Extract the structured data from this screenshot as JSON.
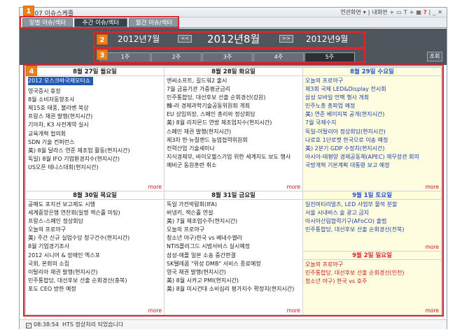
{
  "window": {
    "title": "4107 이슈스케줄"
  },
  "toolbar": {
    "items": [
      "연관화면",
      "▾",
      "|",
      "내화면",
      "+",
      "▭",
      "T",
      "+",
      "▦",
      "?",
      "|",
      "_",
      "✕"
    ]
  },
  "tabs": [
    {
      "label": "일별 이슈/섹터"
    },
    {
      "label": "주간 이슈/섹터"
    },
    {
      "label": "월간 이슈/섹터"
    }
  ],
  "nav": {
    "prev_month": "2012년7월",
    "current_month": "2012년8월",
    "next_month": "2012년9월",
    "prev_button": "<<",
    "next_button": ">>",
    "weeks": [
      "1주",
      "2주",
      "3주",
      "4주",
      "5주"
    ],
    "lookup_button": "조회"
  },
  "badges": [
    "1",
    "2",
    "3",
    "4"
  ],
  "days": [
    {
      "header": "8월 27일 월요일",
      "items": [
        "2012 모스크바국제모터쇼",
        "영국증시 휴장",
        "8월 소비자동향조사",
        "제15호 태풍, 볼라벤 북상",
        "프랑스 채권 발행(현지시간)",
        "기아차, K3 사전계약 실시",
        "교육개혁 협의회",
        "SDN 기술 컨퍼런스",
        "美) 8월 달라스 연준 제조업 활동(현지시간)",
        "독일) 8월 IFO 기업환경지수(현지시간)",
        "US오픈 테니스대회(현지시간)"
      ],
      "more": "more"
    },
    {
      "header": "8월 28일 화요일",
      "items": [
        "엔씨소프트, 길드워2 출시",
        "7월 금융기관 가중평균금리",
        "민주통합당, 대선후보 선출 순회경선(강원)",
        "韓-러 경제과학기술공동위원회 개최",
        "EU 상임의장, 스페인 총리와 정상회담",
        "美) 8월 리치몬드 연방 제조업지수(현지시간)",
        "스페인 채권 발행(현지시간)",
        "제3차 한·뉴질랜드 농업협력위원회",
        "전력산업 기술세미나",
        "지식경제부, 바이오헬스기업 위한 세계지도 보도 행사",
        "예비군 동원훈련 취소"
      ],
      "more": "more"
    },
    {
      "header": "8월 29일 수요일",
      "items": [
        "오늘의 프로야구",
        "제3회 국제 LED&Display 전시회",
        "삼성 모바일 언팩 행사 개최",
        "민주노총 총파업 예정",
        "美) 연준 베이지북 공개(현지시간)",
        "7월 국제수지",
        "독일-이탈리아 정상회담(현지시간)",
        "나로호 1단로켓 한국으로 이송 예정",
        "美) 2분기 GDP 수정치(현지시간)",
        "아시아-태평양 경제공동체(APEC) 재무장관 회의",
        "국방개혁 기본계획 대통령 보고 예정"
      ],
      "more": "more"
    },
    {
      "header": "8월 30일 목요일",
      "items": [
        "공매도 포지션 보고제도 시행",
        "세계중앙은행 연찬회(일명 잭슨홀 미팅)",
        "프랑스-스페인 정상회담",
        "오늘의 프로야구",
        "美) 주간 신규 실업수당 청구건수(현지시간)",
        "8월 기업경기조사",
        "2012 시니어 & 장애인 엑스포",
        "국회, 본회의 소집",
        "이탈리아 채권 발행(현지시간)",
        "민주통합당, 대선후보 선출 순회경선(충북)",
        "포도 CEO 방한 예정"
      ],
      "more": "more"
    },
    {
      "header": "8월 31일 금요일",
      "items": [
        "독일 가전박람회(IFA)",
        "버냉키, 잭슨홀 연설",
        "美) 7월 제조업수주(현지시간)",
        "오늘의 프로야구",
        "청소년 야구)한국 vs 베네수엘라",
        "NTIS플러그드 시범서비스 실시예정",
        "삼성-애플 일본 소송 중간판결",
        "SK텔레콤 \"위성 DMB\" 서비스 종료예정",
        "영국 채권 발행(현지시간)",
        "美) 8월 시카고 PMI(현지시간)",
        "美) 8월 미시건대 소비심리 평가지수 확정치(현지시간)"
      ],
      "more": "more"
    },
    {
      "header": "9월 1일 토요일",
      "items": [
        "일진머티리얼즈, LED 사업부 물적 분할",
        "서울 시내버스 술 광고 금지",
        "아시아산림협력기구(AFoCO) 출범",
        "민주통합당, 대선후보 선출 순회경선(전북)"
      ],
      "more": "more"
    },
    {
      "header": "9월 2일 일요일",
      "items": [
        "오늘의 프로야구",
        "민주통합당, 대선후보 선출 순회경선(인천)",
        "청소년 야구) 한국 vs 호주"
      ],
      "more": "more"
    }
  ],
  "status": {
    "time": "08:38:54",
    "message": "HTS 정상처리 되었습니다"
  },
  "colors": {
    "accent": "#2458b6",
    "highlight_box": "#e0242c",
    "badge": "#f07f15",
    "weekend_bg": "#fffde0"
  }
}
